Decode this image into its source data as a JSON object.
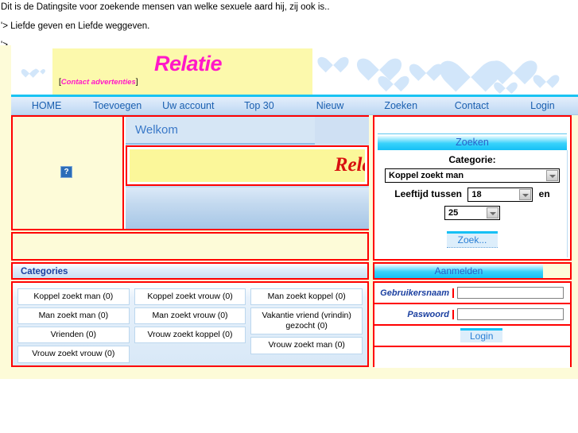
{
  "raw_text": {
    "line1": "Dit is de Datingsite voor zoekende mensen van welke sexuele aard hij, zij ook is..",
    "line2": "'> Liefde geven en Liefde weggeven.",
    "line3": "'>"
  },
  "banner": {
    "title": "Relatie",
    "subtitle_open": "[",
    "subtitle": "Contact advertenties",
    "subtitle_close": "]"
  },
  "nav": {
    "items": [
      {
        "label": "HOME"
      },
      {
        "label": "Toevoegen"
      },
      {
        "label": "Uw account"
      },
      {
        "label": "Top 30"
      },
      {
        "label": "Nieuw"
      },
      {
        "label": "Zoeken"
      },
      {
        "label": "Contact"
      },
      {
        "label": "Login"
      }
    ]
  },
  "welcome": {
    "heading": "Welkom",
    "red_title": "Relatie",
    "broken_image_alt": "?"
  },
  "categories": {
    "heading": "Categories",
    "columns": [
      [
        {
          "label": "Koppel zoekt man (0)"
        },
        {
          "label": "Man zoekt man (0)"
        },
        {
          "label": "Vrienden (0)"
        },
        {
          "label": "Vrouw zoekt vrouw (0)"
        }
      ],
      [
        {
          "label": "Koppel zoekt vrouw (0)"
        },
        {
          "label": "Man zoekt vrouw (0)"
        },
        {
          "label": "Vrouw zoekt koppel (0)"
        }
      ],
      [
        {
          "label": "Man zoekt koppel (0)"
        },
        {
          "label": "Vakantie vriend (vrindin) gezocht (0)"
        },
        {
          "label": "Vrouw zoekt man (0)"
        }
      ]
    ]
  },
  "search": {
    "heading": "Zoeken",
    "category_label": "Categorie:",
    "category_value": "Koppel zoekt man",
    "age_label": "Leeftijd tussen",
    "age_from": "18",
    "age_and": "en",
    "age_to": "25",
    "submit_label": "Zoek..."
  },
  "login": {
    "heading": "Aanmelden",
    "username_label": "Gebruikersnaam",
    "username_value": "",
    "password_label": "Paswoord",
    "password_value": "",
    "submit_label": "Login"
  },
  "colors": {
    "accent_pink": "#ff18c8",
    "accent_red": "#d81010",
    "border_red": "#ff0000",
    "cyan": "#16c0f5",
    "nav_blue": "#1a5fb0",
    "pale_yellow": "#fdfbd8"
  }
}
